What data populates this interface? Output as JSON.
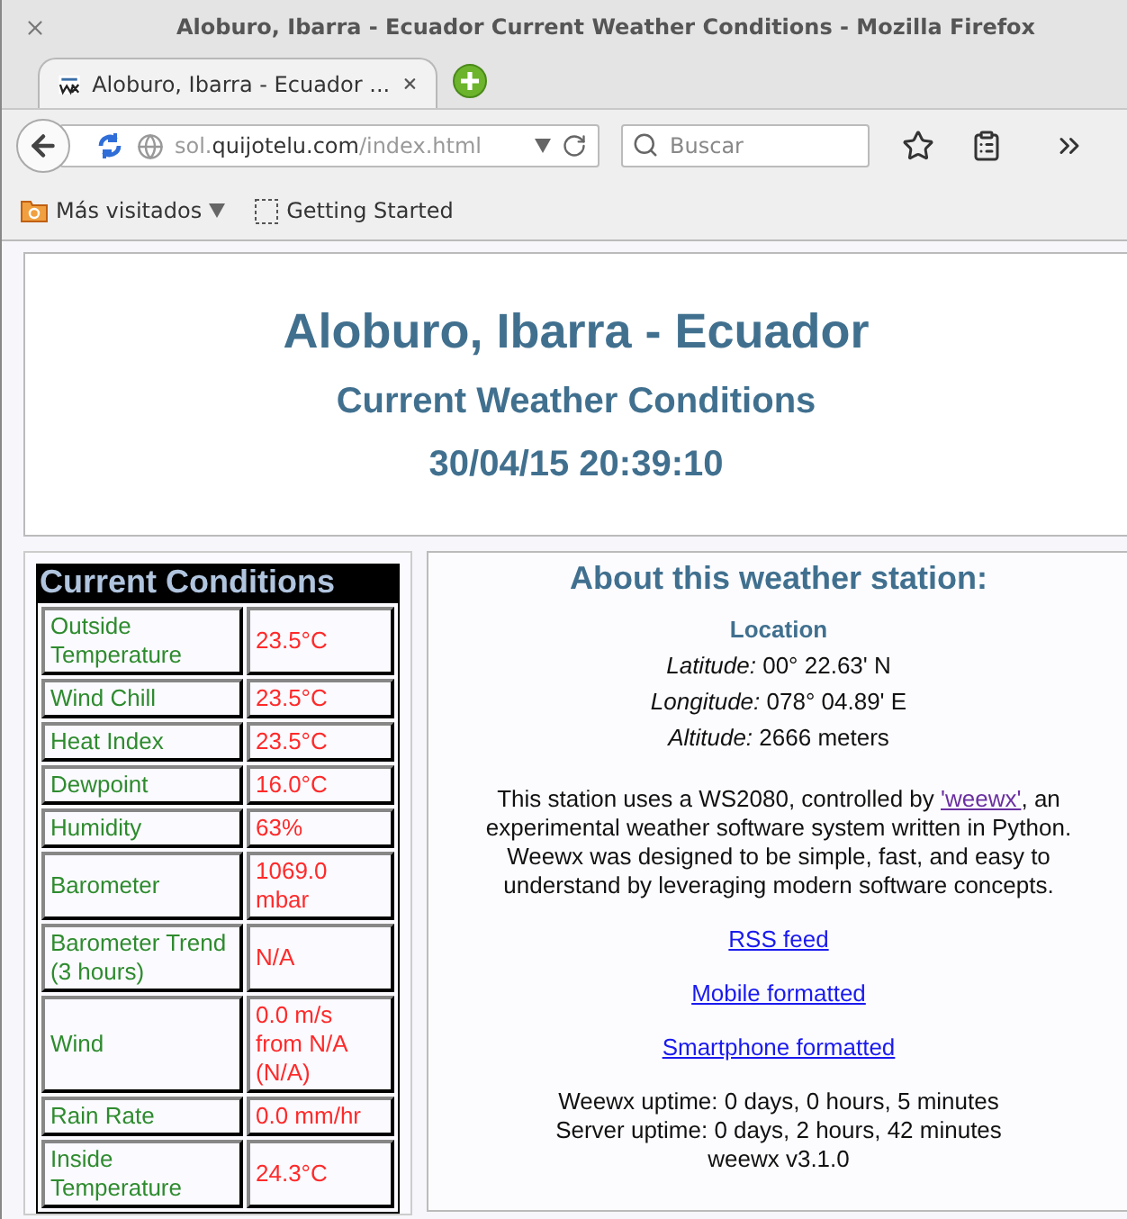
{
  "window": {
    "title": "Aloburo, Ibarra - Ecuador Current Weather Conditions - Mozilla Firefox"
  },
  "tabs": [
    {
      "label": "Aloburo, Ibarra - Ecuador ...",
      "selected": true
    }
  ],
  "toolbar": {
    "url": {
      "subdomain": "sol.",
      "domain": "quijotelu.com",
      "path": "/index.html"
    },
    "search": {
      "placeholder": "Buscar"
    }
  },
  "bookmarks": [
    {
      "kind": "folder",
      "label": "Más visitados"
    },
    {
      "kind": "page",
      "label": "Getting Started"
    }
  ],
  "page": {
    "header": {
      "title": "Aloburo, Ibarra - Ecuador",
      "subtitle": "Current Weather Conditions",
      "timestamp": "30/04/15 20:39:10"
    },
    "conditions": {
      "title": "Current Conditions",
      "rows": [
        {
          "label": "Outside Temperature",
          "value": "23.5°C"
        },
        {
          "label": "Wind Chill",
          "value": "23.5°C"
        },
        {
          "label": "Heat Index",
          "value": "23.5°C"
        },
        {
          "label": "Dewpoint",
          "value": "16.0°C"
        },
        {
          "label": "Humidity",
          "value": "63%"
        },
        {
          "label": "Barometer",
          "value": "1069.0 mbar"
        },
        {
          "label": "Barometer Trend (3 hours)",
          "value": "N/A"
        },
        {
          "label": "Wind",
          "value": "0.0 m/s from N/A (N/A)"
        },
        {
          "label": "Rain Rate",
          "value": "0.0 mm/hr"
        },
        {
          "label": "Inside Temperature",
          "value": "24.3°C"
        }
      ]
    },
    "about": {
      "title": "About this weather station:",
      "location": {
        "heading": "Location",
        "items": [
          "*Latitude:* 00° 22.63' N",
          "*Longitude:* 078° 04.89' E",
          "*Altitude:* 2666 meters"
        ]
      },
      "description": {
        "before": "This station uses a WS2080, controlled by",
        "link": "'weewx'",
        "after": ", an experimental weather software system written in Python. Weewx was designed to be simple, fast, and easy to understand by leveraging modern software concepts."
      },
      "links": [
        "RSS feed",
        "Mobile formatted",
        "Smartphone formatted"
      ],
      "uptime": [
        "Weewx uptime: 0 days, 0 hours, 5 minutes",
        "Server uptime: 0 days, 2 hours, 42 minutes",
        "weewx v3.1.0"
      ]
    }
  }
}
